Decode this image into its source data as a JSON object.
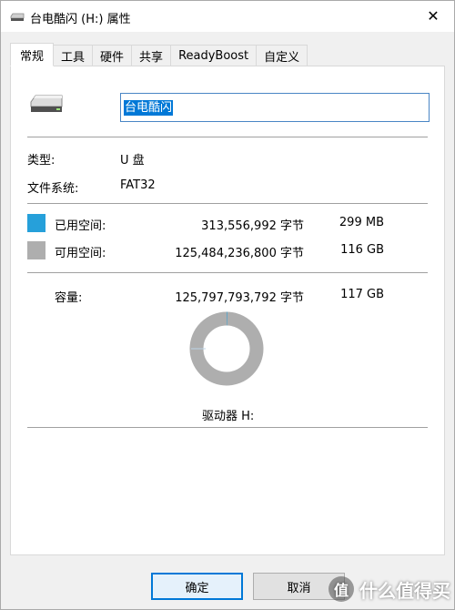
{
  "window": {
    "title": "台电酷闪 (H:) 属性",
    "close_glyph": "✕"
  },
  "tabs": [
    {
      "label": "常规",
      "active": true
    },
    {
      "label": "工具",
      "active": false
    },
    {
      "label": "硬件",
      "active": false
    },
    {
      "label": "共享",
      "active": false
    },
    {
      "label": "ReadyBoost",
      "active": false
    },
    {
      "label": "自定义",
      "active": false
    }
  ],
  "general": {
    "drive_name": "台电酷闪",
    "type_label": "类型:",
    "type_value": "U 盘",
    "fs_label": "文件系统:",
    "fs_value": "FAT32",
    "used": {
      "label": "已用空间:",
      "bytes": "313,556,992 字节",
      "size": "299 MB",
      "color": "#26a0da"
    },
    "free": {
      "label": "可用空间:",
      "bytes": "125,484,236,800 字节",
      "size": "116 GB",
      "color": "#aeaeae"
    },
    "capacity": {
      "label": "容量:",
      "bytes": "125,797,793,792 字节",
      "size": "117 GB"
    },
    "drive_label": "驱动器 H:",
    "used_fraction": 0.0025
  },
  "buttons": {
    "ok": "确定",
    "cancel": "取消"
  },
  "watermark": {
    "text": "什么值得买",
    "logo_glyph": "值"
  }
}
